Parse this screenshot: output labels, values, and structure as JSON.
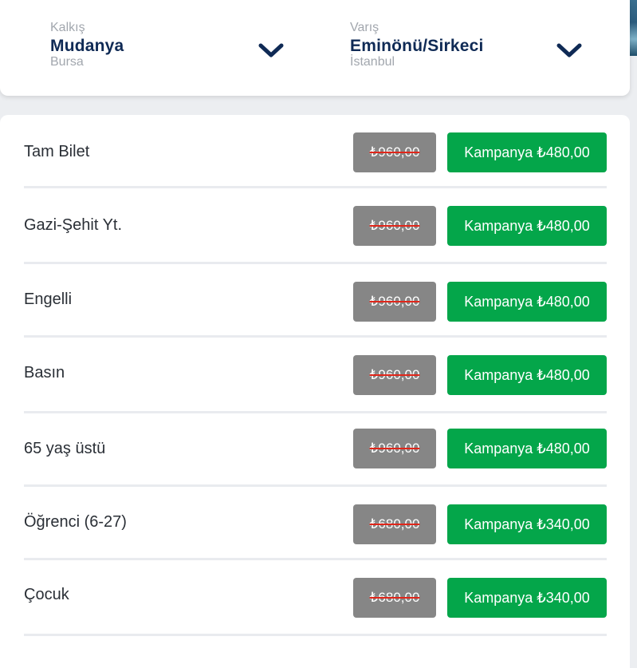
{
  "route": {
    "from": {
      "label": "Kalkış",
      "name": "Mudanya",
      "city": "Bursa"
    },
    "to": {
      "label": "Varış",
      "name": "Eminönü/Sirkeci",
      "city": "İstanbul"
    }
  },
  "fares": [
    {
      "name": "Tam Bilet",
      "old_price": "₺960,00",
      "campaign": "Kampanya ₺480,00"
    },
    {
      "name": "Gazi-Şehit Yt.",
      "old_price": "₺960,00",
      "campaign": "Kampanya ₺480,00"
    },
    {
      "name": "Engelli",
      "old_price": "₺960,00",
      "campaign": "Kampanya ₺480,00"
    },
    {
      "name": "Basın",
      "old_price": "₺960,00",
      "campaign": "Kampanya ₺480,00"
    },
    {
      "name": "65 yaş üstü",
      "old_price": "₺960,00",
      "campaign": "Kampanya ₺480,00"
    },
    {
      "name": "Öğrenci (6-27)",
      "old_price": "₺680,00",
      "campaign": "Kampanya ₺340,00"
    },
    {
      "name": "Çocuk",
      "old_price": "₺680,00",
      "campaign": "Kampanya ₺340,00"
    }
  ],
  "colors": {
    "navy": "#0f2a55",
    "campaign_green": "#04a64a",
    "old_price_gray": "#868686",
    "strike_red": "#e0261a"
  }
}
